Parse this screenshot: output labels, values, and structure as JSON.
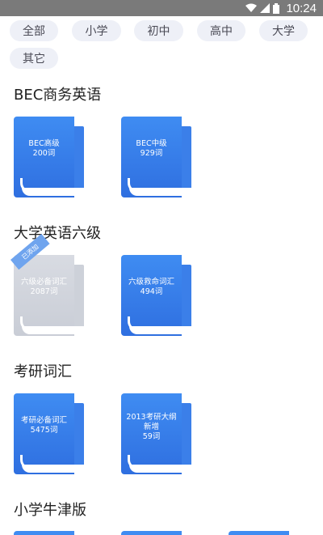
{
  "status_bar": {
    "time": "10:24"
  },
  "filters": [
    "全部",
    "小学",
    "初中",
    "高中",
    "大学",
    "其它"
  ],
  "sections": [
    {
      "title": "BEC商务英语",
      "books": [
        {
          "name": "BEC高级",
          "count": "200词",
          "added": false
        },
        {
          "name": "BEC中级",
          "count": "929词",
          "added": false
        }
      ]
    },
    {
      "title": "大学英语六级",
      "books": [
        {
          "name": "六级必备词汇",
          "count": "2087词",
          "added": true,
          "badge": "已添加"
        },
        {
          "name": "六级救命词汇",
          "count": "494词",
          "added": false
        }
      ]
    },
    {
      "title": "考研词汇",
      "books": [
        {
          "name": "考研必备词汇",
          "count": "5475词",
          "added": false
        },
        {
          "name": "2013考研大纲新增",
          "count": "59词",
          "added": false
        }
      ]
    },
    {
      "title": "小学牛津版",
      "books": []
    }
  ],
  "colors": {
    "book_blue": "#3f8cf2",
    "book_gray": "#d8dbe2",
    "chip_bg": "#eef0f7"
  }
}
